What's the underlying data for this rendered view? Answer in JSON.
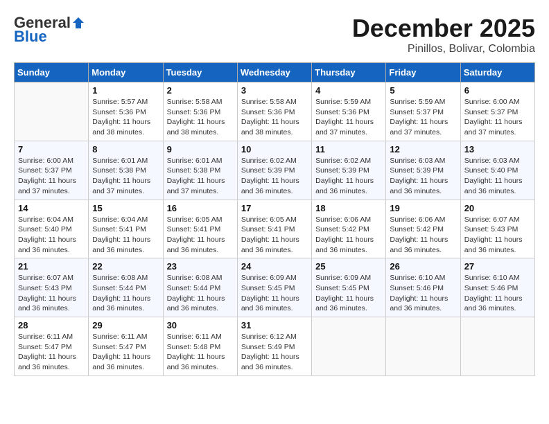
{
  "header": {
    "logo_general": "General",
    "logo_blue": "Blue",
    "month": "December 2025",
    "location": "Pinillos, Bolivar, Colombia"
  },
  "days_of_week": [
    "Sunday",
    "Monday",
    "Tuesday",
    "Wednesday",
    "Thursday",
    "Friday",
    "Saturday"
  ],
  "weeks": [
    [
      {
        "day": "",
        "info": ""
      },
      {
        "day": "1",
        "info": "Sunrise: 5:57 AM\nSunset: 5:36 PM\nDaylight: 11 hours\nand 38 minutes."
      },
      {
        "day": "2",
        "info": "Sunrise: 5:58 AM\nSunset: 5:36 PM\nDaylight: 11 hours\nand 38 minutes."
      },
      {
        "day": "3",
        "info": "Sunrise: 5:58 AM\nSunset: 5:36 PM\nDaylight: 11 hours\nand 38 minutes."
      },
      {
        "day": "4",
        "info": "Sunrise: 5:59 AM\nSunset: 5:36 PM\nDaylight: 11 hours\nand 37 minutes."
      },
      {
        "day": "5",
        "info": "Sunrise: 5:59 AM\nSunset: 5:37 PM\nDaylight: 11 hours\nand 37 minutes."
      },
      {
        "day": "6",
        "info": "Sunrise: 6:00 AM\nSunset: 5:37 PM\nDaylight: 11 hours\nand 37 minutes."
      }
    ],
    [
      {
        "day": "7",
        "info": "Sunrise: 6:00 AM\nSunset: 5:37 PM\nDaylight: 11 hours\nand 37 minutes."
      },
      {
        "day": "8",
        "info": "Sunrise: 6:01 AM\nSunset: 5:38 PM\nDaylight: 11 hours\nand 37 minutes."
      },
      {
        "day": "9",
        "info": "Sunrise: 6:01 AM\nSunset: 5:38 PM\nDaylight: 11 hours\nand 37 minutes."
      },
      {
        "day": "10",
        "info": "Sunrise: 6:02 AM\nSunset: 5:39 PM\nDaylight: 11 hours\nand 36 minutes."
      },
      {
        "day": "11",
        "info": "Sunrise: 6:02 AM\nSunset: 5:39 PM\nDaylight: 11 hours\nand 36 minutes."
      },
      {
        "day": "12",
        "info": "Sunrise: 6:03 AM\nSunset: 5:39 PM\nDaylight: 11 hours\nand 36 minutes."
      },
      {
        "day": "13",
        "info": "Sunrise: 6:03 AM\nSunset: 5:40 PM\nDaylight: 11 hours\nand 36 minutes."
      }
    ],
    [
      {
        "day": "14",
        "info": "Sunrise: 6:04 AM\nSunset: 5:40 PM\nDaylight: 11 hours\nand 36 minutes."
      },
      {
        "day": "15",
        "info": "Sunrise: 6:04 AM\nSunset: 5:41 PM\nDaylight: 11 hours\nand 36 minutes."
      },
      {
        "day": "16",
        "info": "Sunrise: 6:05 AM\nSunset: 5:41 PM\nDaylight: 11 hours\nand 36 minutes."
      },
      {
        "day": "17",
        "info": "Sunrise: 6:05 AM\nSunset: 5:41 PM\nDaylight: 11 hours\nand 36 minutes."
      },
      {
        "day": "18",
        "info": "Sunrise: 6:06 AM\nSunset: 5:42 PM\nDaylight: 11 hours\nand 36 minutes."
      },
      {
        "day": "19",
        "info": "Sunrise: 6:06 AM\nSunset: 5:42 PM\nDaylight: 11 hours\nand 36 minutes."
      },
      {
        "day": "20",
        "info": "Sunrise: 6:07 AM\nSunset: 5:43 PM\nDaylight: 11 hours\nand 36 minutes."
      }
    ],
    [
      {
        "day": "21",
        "info": "Sunrise: 6:07 AM\nSunset: 5:43 PM\nDaylight: 11 hours\nand 36 minutes."
      },
      {
        "day": "22",
        "info": "Sunrise: 6:08 AM\nSunset: 5:44 PM\nDaylight: 11 hours\nand 36 minutes."
      },
      {
        "day": "23",
        "info": "Sunrise: 6:08 AM\nSunset: 5:44 PM\nDaylight: 11 hours\nand 36 minutes."
      },
      {
        "day": "24",
        "info": "Sunrise: 6:09 AM\nSunset: 5:45 PM\nDaylight: 11 hours\nand 36 minutes."
      },
      {
        "day": "25",
        "info": "Sunrise: 6:09 AM\nSunset: 5:45 PM\nDaylight: 11 hours\nand 36 minutes."
      },
      {
        "day": "26",
        "info": "Sunrise: 6:10 AM\nSunset: 5:46 PM\nDaylight: 11 hours\nand 36 minutes."
      },
      {
        "day": "27",
        "info": "Sunrise: 6:10 AM\nSunset: 5:46 PM\nDaylight: 11 hours\nand 36 minutes."
      }
    ],
    [
      {
        "day": "28",
        "info": "Sunrise: 6:11 AM\nSunset: 5:47 PM\nDaylight: 11 hours\nand 36 minutes."
      },
      {
        "day": "29",
        "info": "Sunrise: 6:11 AM\nSunset: 5:47 PM\nDaylight: 11 hours\nand 36 minutes."
      },
      {
        "day": "30",
        "info": "Sunrise: 6:11 AM\nSunset: 5:48 PM\nDaylight: 11 hours\nand 36 minutes."
      },
      {
        "day": "31",
        "info": "Sunrise: 6:12 AM\nSunset: 5:49 PM\nDaylight: 11 hours\nand 36 minutes."
      },
      {
        "day": "",
        "info": ""
      },
      {
        "day": "",
        "info": ""
      },
      {
        "day": "",
        "info": ""
      }
    ]
  ]
}
